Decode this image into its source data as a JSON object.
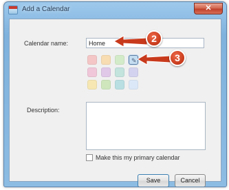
{
  "window": {
    "title": "Add a Calendar",
    "close_glyph": "✕"
  },
  "form": {
    "name_label": "Calendar name:",
    "name_value": "Home",
    "description_label": "Description:",
    "description_value": "",
    "primary_label": "Make this my primary calendar",
    "primary_checked": false
  },
  "colors": {
    "selected_index": 3,
    "selected_icon": "pencil-icon",
    "selected_glyph": "✎",
    "swatches": [
      "#f4c6c6",
      "#f8dcb2",
      "#d4ebc9",
      "#c5ddf0",
      "#f0c7d8",
      "#e0c8e8",
      "#c3e3dd",
      "#d3d3ef",
      "#f6e7b3",
      "#cfe6bd",
      "#b9dfe2",
      "#dbe8f7"
    ]
  },
  "buttons": {
    "save": "Save",
    "cancel": "Cancel"
  },
  "callouts": [
    {
      "number": "2",
      "target": "calendar-name-input"
    },
    {
      "number": "3",
      "target": "selected-color-swatch"
    }
  ],
  "theme": {
    "callout_color": "#c83a1c",
    "titlebar_color": "#7fb2dd"
  }
}
